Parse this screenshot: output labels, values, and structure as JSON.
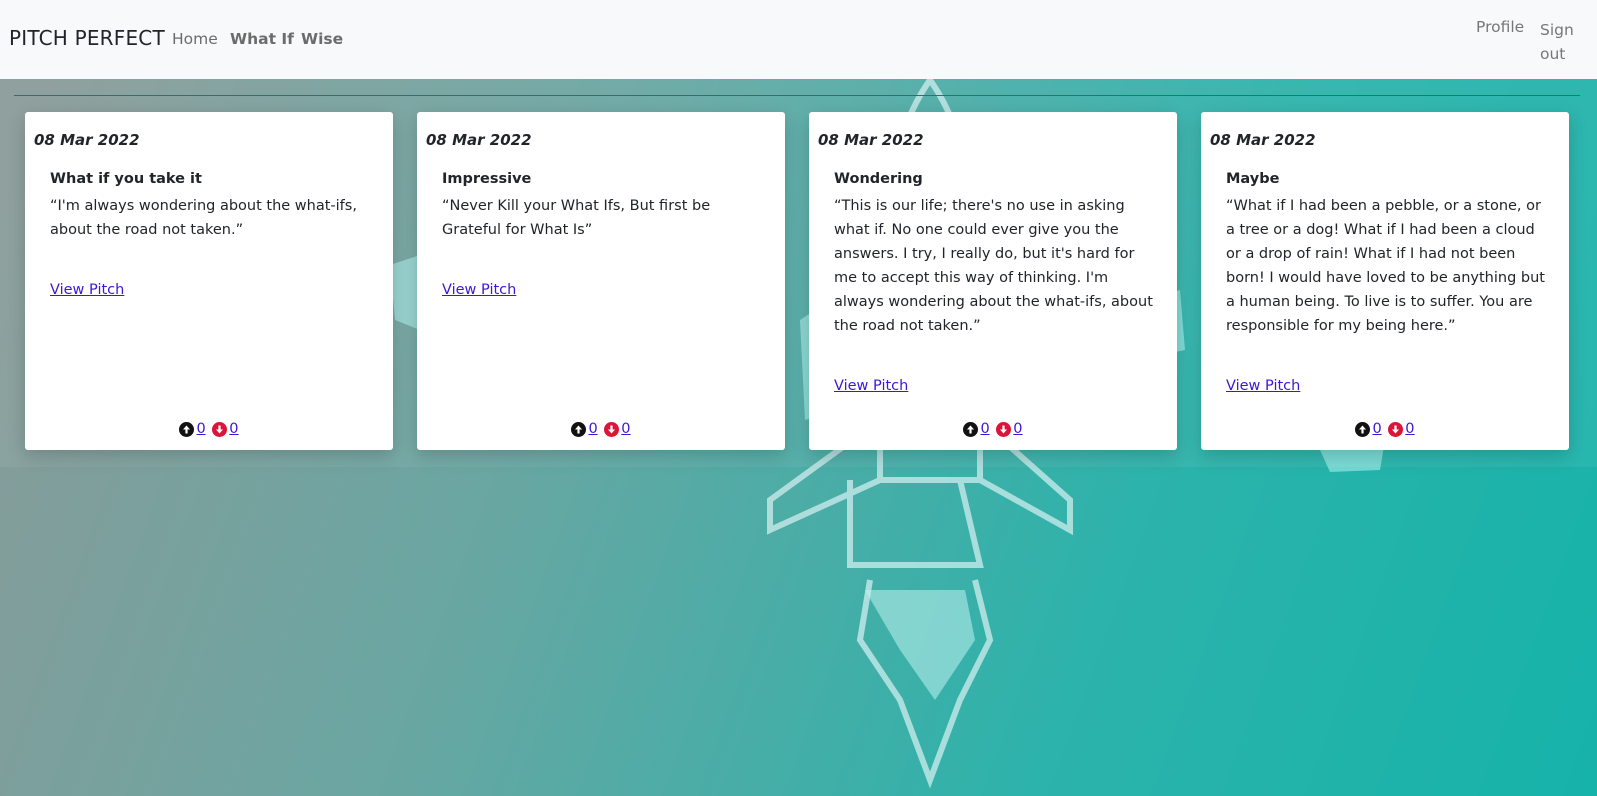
{
  "nav": {
    "brand": "PITCH PERFECT",
    "links": [
      "Home",
      "What If",
      "Wise"
    ],
    "profile": "Profile",
    "signout": "Sign out"
  },
  "cards": [
    {
      "date": "08 Mar 2022",
      "title": "What if you take it",
      "quote": "“I'm always wondering about the what-ifs, about the road not taken.”",
      "link": "View Pitch",
      "upvotes": "0",
      "downvotes": "0"
    },
    {
      "date": "08 Mar 2022",
      "title": "Impressive",
      "quote": "“Never Kill your What Ifs, But first be Grateful for What Is”",
      "link": "View Pitch",
      "upvotes": "0",
      "downvotes": "0"
    },
    {
      "date": "08 Mar 2022",
      "title": "Wondering",
      "quote": "“This is our life; there's no use in asking what if. No one could ever give you the answers. I try, I really do, but it's hard for me to accept this way of thinking. I'm always wondering about the what-ifs, about the road not taken.”",
      "link": "View Pitch",
      "upvotes": "0",
      "downvotes": "0"
    },
    {
      "date": "08 Mar 2022",
      "title": "Maybe",
      "quote": "“What if I had been a pebble, or a stone, or a tree or a dog! What if I had been a cloud or a drop of rain! What if I had not been born! I would have loved to be anything but a human being. To live is to suffer. You are responsible for my being here.”",
      "link": "View Pitch",
      "upvotes": "0",
      "downvotes": "0"
    }
  ],
  "icons": {
    "upvote": "arrow-up-circle-icon",
    "downvote": "arrow-down-circle-icon"
  },
  "colors": {
    "link": "#3d17d6",
    "upvote": "#111111",
    "downvote": "#dc143c",
    "navbar": "#f8f9fa"
  }
}
